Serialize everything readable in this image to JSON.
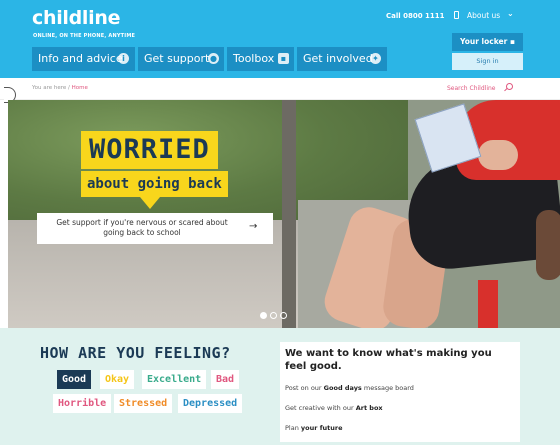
{
  "header": {
    "logo": "childline",
    "tagline": "ONLINE, ON THE PHONE, ANYTIME",
    "call_label": "Call 0800 1111",
    "about_label": "About us",
    "locker_label": "Your locker",
    "signin_label": "Sign in",
    "brand_color": "#2bb5e6",
    "nav_color": "#1c8fc4"
  },
  "nav": {
    "items": [
      {
        "label": "Info and advice",
        "icon": "info-icon"
      },
      {
        "label": "Get support",
        "icon": "person-icon"
      },
      {
        "label": "Toolbox",
        "icon": "toolbox-icon"
      },
      {
        "label": "Get involved",
        "icon": "star-icon"
      }
    ]
  },
  "breadcrumb": {
    "prefix": "You are here / ",
    "current": "Home"
  },
  "search": {
    "label": "Search Childline"
  },
  "hero": {
    "headline": "WORRIED",
    "subheadline": "about going back",
    "cta_text": "Get support if you're nervous or scared about going back to school",
    "cta_arrow": "→",
    "slides": 3,
    "active_slide": 1,
    "accent": "#f8d61c"
  },
  "feelings": {
    "title": "HOW ARE YOU FEELING?",
    "moods": [
      {
        "label": "Good",
        "color": "#ffffff",
        "bg": "#1b3a55"
      },
      {
        "label": "Okay",
        "color": "#f5c518",
        "bg": "#ffffff"
      },
      {
        "label": "Excellent",
        "color": "#3aab8c",
        "bg": "#ffffff"
      },
      {
        "label": "Bad",
        "color": "#e0577f",
        "bg": "#ffffff"
      },
      {
        "label": "Horrible",
        "color": "#e0577f",
        "bg": "#ffffff"
      },
      {
        "label": "Stressed",
        "color": "#f08c28",
        "bg": "#ffffff"
      },
      {
        "label": "Depressed",
        "color": "#2b8fc4",
        "bg": "#ffffff"
      }
    ]
  },
  "panel": {
    "title": "We want to know what's making you feel good.",
    "lines": [
      {
        "pre": "Post on our ",
        "bold": "Good days",
        "post": " message board"
      },
      {
        "pre": "Get creative with our ",
        "bold": "Art box",
        "post": ""
      },
      {
        "pre": "Plan ",
        "bold": "your future",
        "post": ""
      }
    ]
  }
}
